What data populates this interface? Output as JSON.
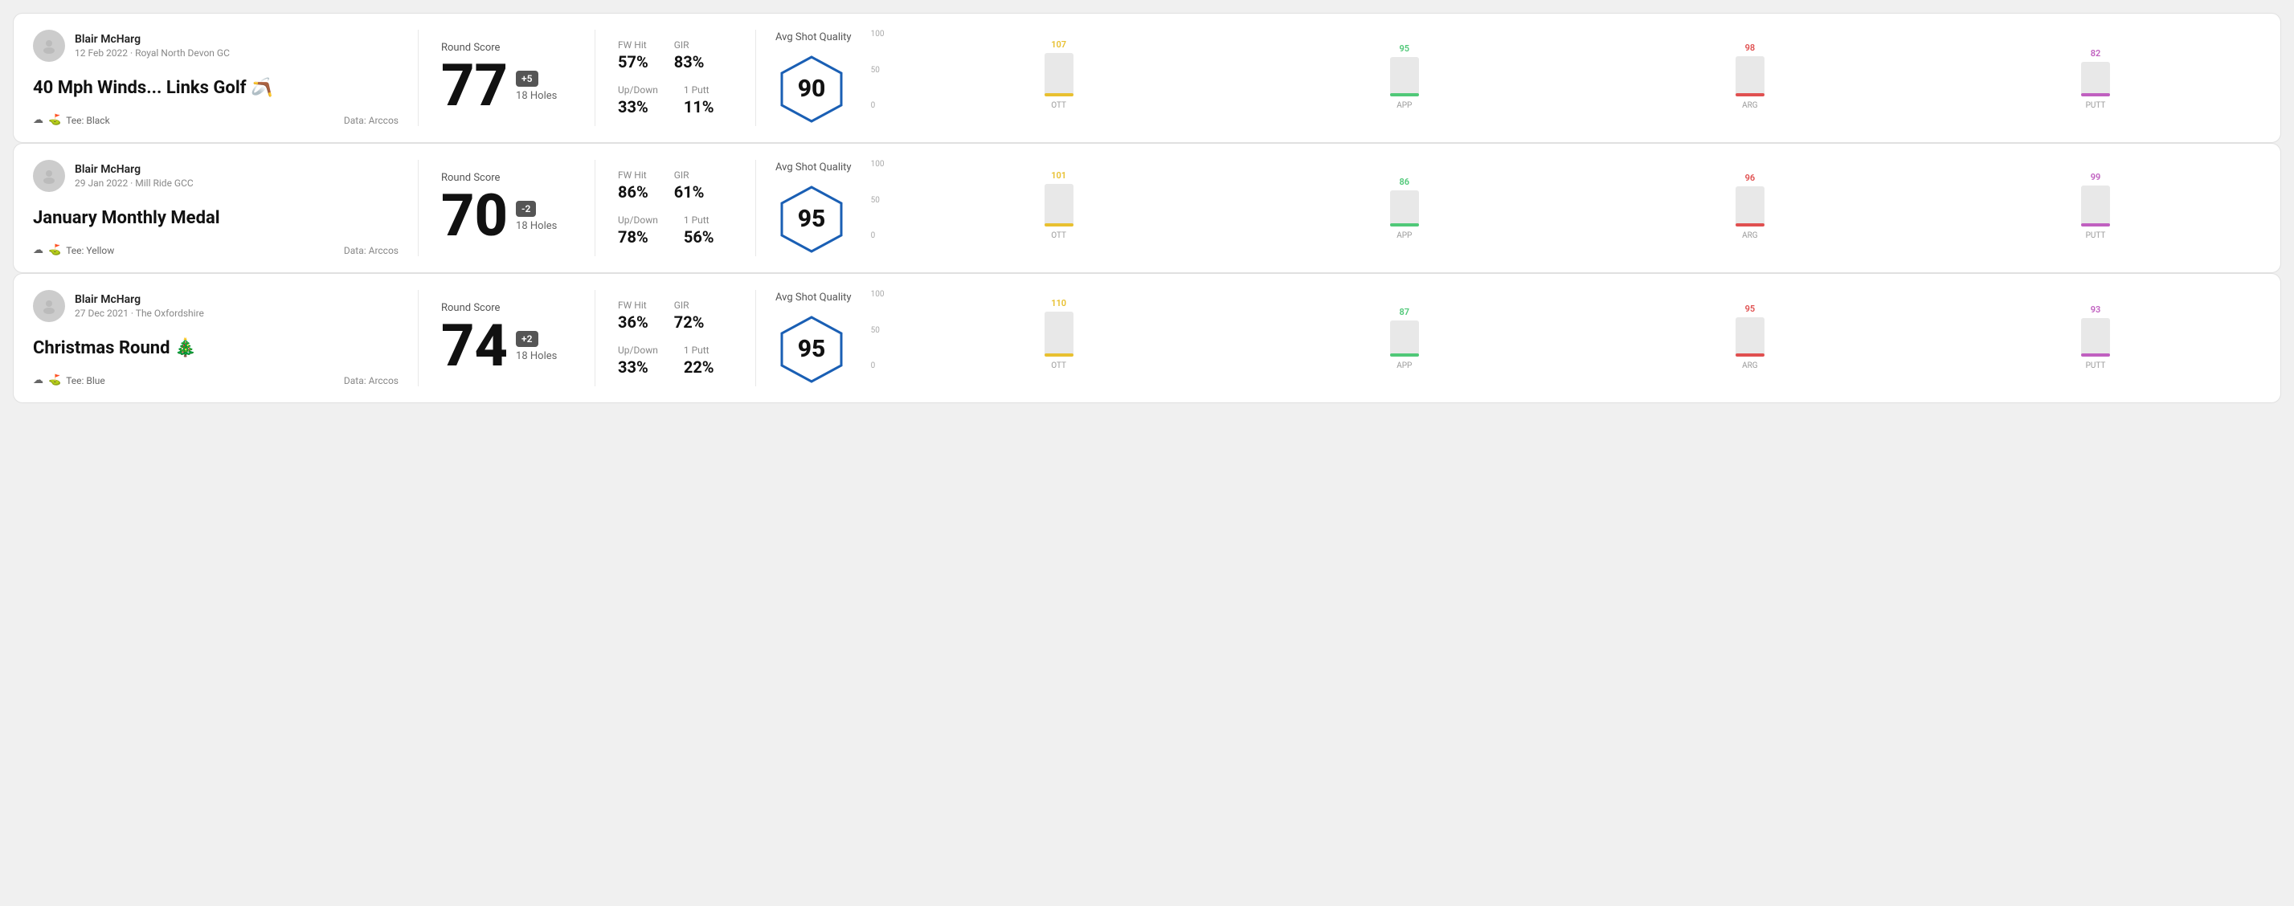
{
  "rounds": [
    {
      "id": "round1",
      "user": {
        "name": "Blair McHarg",
        "date": "12 Feb 2022 · Royal North Devon GC"
      },
      "title": "40 Mph Winds... Links Golf",
      "title_emoji": "🪃",
      "tee": "Tee: Black",
      "data_source": "Data: Arccos",
      "score": {
        "label": "Round Score",
        "value": "77",
        "modifier": "+5",
        "holes": "18 Holes"
      },
      "stats": {
        "fw_hit_label": "FW Hit",
        "fw_hit_value": "57%",
        "gir_label": "GIR",
        "gir_value": "83%",
        "updown_label": "Up/Down",
        "updown_value": "33%",
        "oneputt_label": "1 Putt",
        "oneputt_value": "11%"
      },
      "quality": {
        "label": "Avg Shot Quality",
        "value": "90"
      },
      "chart": {
        "y_labels": [
          "100",
          "50",
          "0"
        ],
        "bars": [
          {
            "label": "OTT",
            "value": 107,
            "color": "#e8c030",
            "bar_height_pct": 72
          },
          {
            "label": "APP",
            "value": 95,
            "color": "#50c878",
            "bar_height_pct": 65
          },
          {
            "label": "ARG",
            "value": 98,
            "color": "#e05050",
            "bar_height_pct": 67
          },
          {
            "label": "PUTT",
            "value": 82,
            "color": "#c060c0",
            "bar_height_pct": 57
          }
        ]
      }
    },
    {
      "id": "round2",
      "user": {
        "name": "Blair McHarg",
        "date": "29 Jan 2022 · Mill Ride GCC"
      },
      "title": "January Monthly Medal",
      "title_emoji": "",
      "tee": "Tee: Yellow",
      "data_source": "Data: Arccos",
      "score": {
        "label": "Round Score",
        "value": "70",
        "modifier": "-2",
        "holes": "18 Holes"
      },
      "stats": {
        "fw_hit_label": "FW Hit",
        "fw_hit_value": "86%",
        "gir_label": "GIR",
        "gir_value": "61%",
        "updown_label": "Up/Down",
        "updown_value": "78%",
        "oneputt_label": "1 Putt",
        "oneputt_value": "56%"
      },
      "quality": {
        "label": "Avg Shot Quality",
        "value": "95"
      },
      "chart": {
        "y_labels": [
          "100",
          "50",
          "0"
        ],
        "bars": [
          {
            "label": "OTT",
            "value": 101,
            "color": "#e8c030",
            "bar_height_pct": 70
          },
          {
            "label": "APP",
            "value": 86,
            "color": "#50c878",
            "bar_height_pct": 60
          },
          {
            "label": "ARG",
            "value": 96,
            "color": "#e05050",
            "bar_height_pct": 66
          },
          {
            "label": "PUTT",
            "value": 99,
            "color": "#c060c0",
            "bar_height_pct": 68
          }
        ]
      }
    },
    {
      "id": "round3",
      "user": {
        "name": "Blair McHarg",
        "date": "27 Dec 2021 · The Oxfordshire"
      },
      "title": "Christmas Round",
      "title_emoji": "🎄",
      "tee": "Tee: Blue",
      "data_source": "Data: Arccos",
      "score": {
        "label": "Round Score",
        "value": "74",
        "modifier": "+2",
        "holes": "18 Holes"
      },
      "stats": {
        "fw_hit_label": "FW Hit",
        "fw_hit_value": "36%",
        "gir_label": "GIR",
        "gir_value": "72%",
        "updown_label": "Up/Down",
        "updown_value": "33%",
        "oneputt_label": "1 Putt",
        "oneputt_value": "22%"
      },
      "quality": {
        "label": "Avg Shot Quality",
        "value": "95"
      },
      "chart": {
        "y_labels": [
          "100",
          "50",
          "0"
        ],
        "bars": [
          {
            "label": "OTT",
            "value": 110,
            "color": "#e8c030",
            "bar_height_pct": 74
          },
          {
            "label": "APP",
            "value": 87,
            "color": "#50c878",
            "bar_height_pct": 60
          },
          {
            "label": "ARG",
            "value": 95,
            "color": "#e05050",
            "bar_height_pct": 65
          },
          {
            "label": "PUTT",
            "value": 93,
            "color": "#c060c0",
            "bar_height_pct": 64
          }
        ]
      }
    }
  ]
}
